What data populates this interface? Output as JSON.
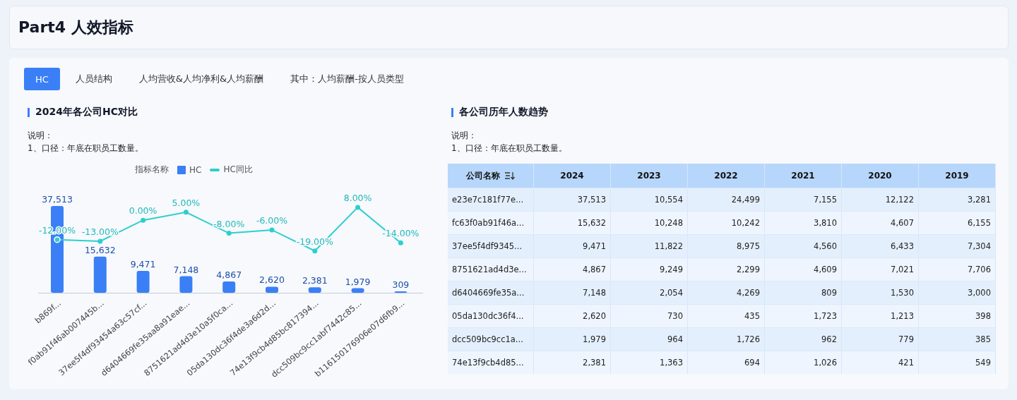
{
  "header": {
    "title": "Part4 人效指标"
  },
  "tabs": [
    {
      "label": "HC",
      "selected": true
    },
    {
      "label": "人员结构",
      "selected": false
    },
    {
      "label": "人均营收&人均净利&人均薪酬",
      "selected": false
    },
    {
      "label": "其中：人均薪酬-按人员类型",
      "selected": false
    }
  ],
  "left_panel": {
    "title": "2024年各公司HC对比",
    "notes": [
      "说明：",
      "1、口径：年底在职员工数量。"
    ],
    "legend_title": "指标名称",
    "hc_bars": {
      "chart_data": {
        "type": "bar",
        "categories": [
          "b869f...",
          "f0ab91f46ab007445b...",
          "37ee5f4df93454a63c57cf...",
          "d6404669fe35aa8a91eae...",
          "8751621ad4d3e10a5f0ca...",
          "05da130dc36f4de3a6d2d...",
          "74e13f9cb4d85bc817394...",
          "dcc509bc9cc1abf7442c85...",
          "b116150176906e07d6fb9..."
        ],
        "series": [
          {
            "name": "HC",
            "color": "#3a7ff6",
            "values": [
              37513,
              15632,
              9471,
              7148,
              4867,
              2620,
              2381,
              1979,
              309
            ],
            "value_labels": [
              "37,513",
              "15,632",
              "9,471",
              "7,148",
              "4,867",
              "2,620",
              "2,381",
              "1,979",
              "309"
            ]
          }
        ],
        "data_labels": true
      }
    },
    "hc_yoy": {
      "chart_data": {
        "type": "line",
        "series": [
          {
            "name": "HC同比",
            "color": "#2ccfcf",
            "marker": "o",
            "values": [
              -12,
              -13,
              0,
              5,
              -8,
              -6,
              -19,
              8,
              -14
            ],
            "value_labels": [
              "-12.00%",
              "-13.00%",
              "0.00%",
              "5.00%",
              "-8.00%",
              "-6.00%",
              "-19.00%",
              "8.00%",
              "-14.00%"
            ]
          }
        ],
        "data_labels": true
      }
    }
  },
  "right_panel": {
    "title": "各公司历年人数趋势",
    "notes": [
      "说明：",
      "1、口径：年底在职员工数量。"
    ],
    "table": {
      "columns": [
        "公司名称",
        "2024",
        "2023",
        "2022",
        "2021",
        "2020",
        "2019"
      ],
      "rows": [
        [
          "e23e7c181f77e...",
          "37,513",
          "10,554",
          "24,499",
          "7,155",
          "12,122",
          "3,281"
        ],
        [
          "fc63f0ab91f46a...",
          "15,632",
          "10,248",
          "10,242",
          "3,810",
          "4,607",
          "6,155"
        ],
        [
          "37ee5f4df9345...",
          "9,471",
          "11,822",
          "8,975",
          "4,560",
          "6,433",
          "7,304"
        ],
        [
          "8751621ad4d3e...",
          "4,867",
          "9,249",
          "2,299",
          "4,609",
          "7,021",
          "7,706"
        ],
        [
          "d6404669fe35a...",
          "7,148",
          "2,054",
          "4,269",
          "809",
          "1,530",
          "3,000"
        ],
        [
          "05da130dc36f4...",
          "2,620",
          "730",
          "435",
          "1,723",
          "1,213",
          "398"
        ],
        [
          "dcc509bc9cc1a...",
          "1,979",
          "964",
          "1,726",
          "962",
          "779",
          "385"
        ],
        [
          "74e13f9cb4d85...",
          "2,381",
          "1,363",
          "694",
          "1,026",
          "421",
          "549"
        ]
      ]
    }
  }
}
